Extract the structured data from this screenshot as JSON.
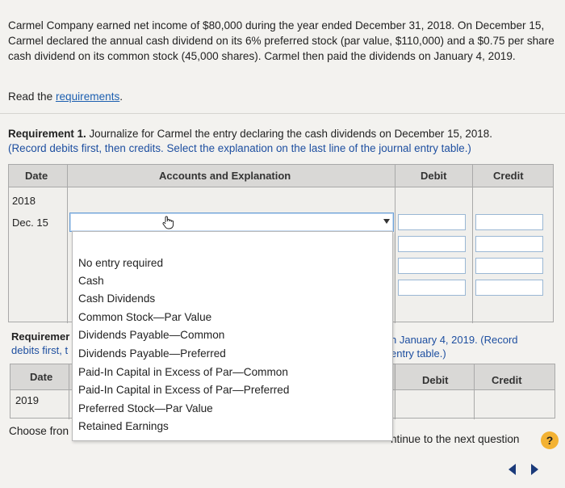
{
  "problem": {
    "text": "Carmel Company earned net income of $80,000 during the year ended December 31, 2018. On December 15, Carmel declared the annual cash dividend on its 6% preferred stock (par value, $110,000) and a $0.75 per share cash dividend on its common stock (45,000 shares). Carmel then paid the dividends on January 4, 2019.",
    "read_prefix": "Read the ",
    "read_link": "requirements",
    "read_suffix": "."
  },
  "req1": {
    "label": "Requirement 1.",
    "text": " Journalize for Carmel the entry declaring the cash dividends on December 15, 2018.",
    "note": "(Record debits first, then credits. Select the explanation on the last line of the journal entry table.)"
  },
  "table1": {
    "col_date": "Date",
    "col_accounts": "Accounts and Explanation",
    "col_debit": "Debit",
    "col_credit": "Credit",
    "year": "2018",
    "day": "Dec. 15"
  },
  "dropdown": {
    "options": [
      "No entry required",
      "Cash",
      "Cash Dividends",
      "Common Stock—Par Value",
      "Dividends Payable—Common",
      "Dividends Payable—Preferred",
      "Paid-In Capital in Excess of Par—Common",
      "Paid-In Capital in Excess of Par—Preferred",
      "Preferred Stock—Par Value",
      "Retained Earnings"
    ]
  },
  "req2": {
    "label_partial": "Requiremer",
    "note_partial": "debits first, t",
    "right_line1": "n January 4, 2019. (Record",
    "right_line2": "entry table.)"
  },
  "table2": {
    "col_date": "Date",
    "col_debit": "Debit",
    "col_credit": "Credit",
    "year": "2019"
  },
  "footer": {
    "choose_partial": "Choose fron",
    "continue_partial": "ntinue to the next question",
    "help": "?"
  }
}
